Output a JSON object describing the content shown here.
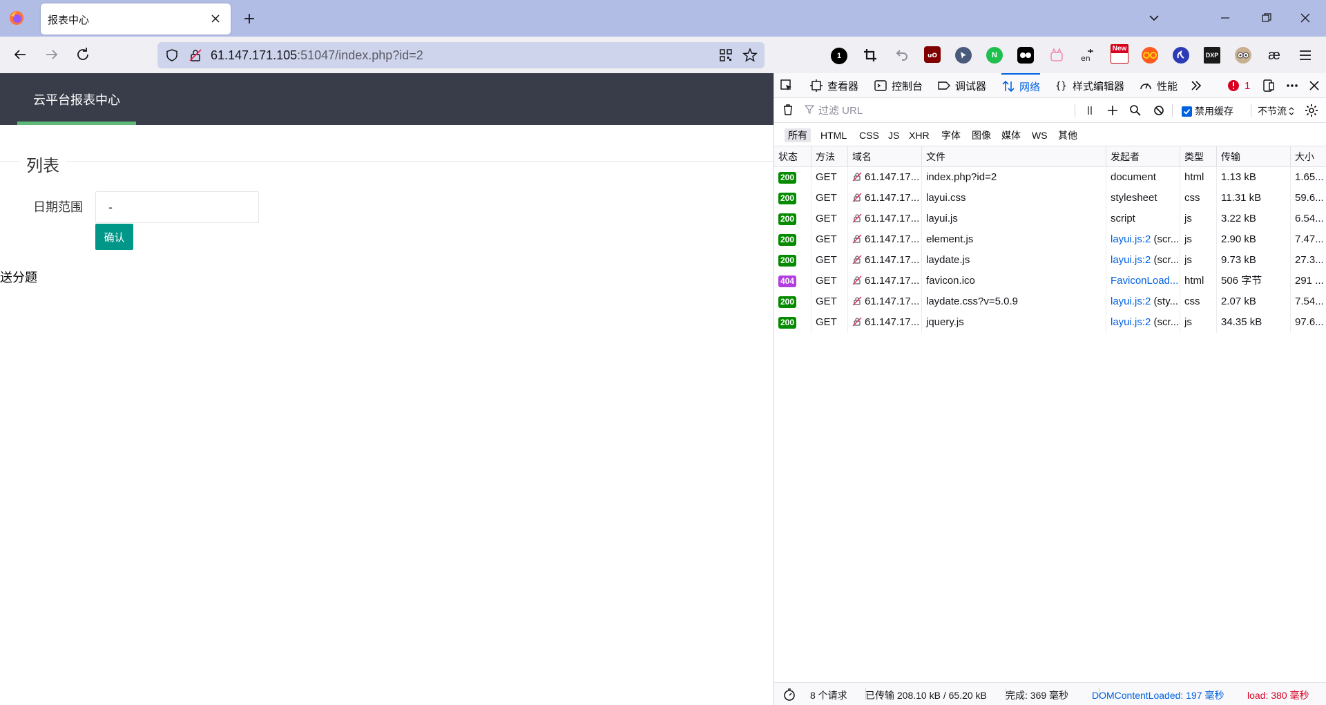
{
  "browser": {
    "tab_title": "报表中心",
    "url_host": "61.147.171.105",
    "url_rest": ":51047/index.php?id=2"
  },
  "extensions": [
    "1",
    "crop",
    "undo",
    "uBlock",
    "cursor",
    "N",
    "tampermonkey",
    "cat",
    "en",
    "New",
    "glasses",
    "sync",
    "DXP",
    "owl",
    "æ"
  ],
  "page": {
    "app_title": "云平台报表中心",
    "section_title": "列表",
    "date_label": "日期范围",
    "date_value": "-",
    "confirm_label": "确认",
    "bonus_text": "送分题"
  },
  "devtools": {
    "tabs": {
      "inspector": "查看器",
      "console": "控制台",
      "debugger": "调试器",
      "network": "网络",
      "style_editor": "样式编辑器",
      "performance": "性能"
    },
    "error_count": "1",
    "filter_placeholder": "过滤 URL",
    "disable_cache": "禁用缓存",
    "throttle": "不节流",
    "type_filters": [
      "所有",
      "HTML",
      "CSS",
      "JS",
      "XHR",
      "字体",
      "图像",
      "媒体",
      "WS",
      "其他"
    ],
    "columns": [
      "状态",
      "方法",
      "域名",
      "文件",
      "发起者",
      "类型",
      "传输",
      "大小"
    ],
    "requests": [
      {
        "status": "200",
        "method": "GET",
        "domain": "61.147.17...",
        "file": "index.php?id=2",
        "initiator": "document",
        "initiator_extra": "",
        "type": "html",
        "transfer": "1.13 kB",
        "size": "1.65..."
      },
      {
        "status": "200",
        "method": "GET",
        "domain": "61.147.17...",
        "file": "layui.css",
        "initiator": "stylesheet",
        "initiator_extra": "",
        "type": "css",
        "transfer": "11.31 kB",
        "size": "59.6..."
      },
      {
        "status": "200",
        "method": "GET",
        "domain": "61.147.17...",
        "file": "layui.js",
        "initiator": "script",
        "initiator_extra": "",
        "type": "js",
        "transfer": "3.22 kB",
        "size": "6.54..."
      },
      {
        "status": "200",
        "method": "GET",
        "domain": "61.147.17...",
        "file": "element.js",
        "initiator": "layui.js:2",
        "initiator_extra": " (scr...",
        "type": "js",
        "transfer": "2.90 kB",
        "size": "7.47..."
      },
      {
        "status": "200",
        "method": "GET",
        "domain": "61.147.17...",
        "file": "laydate.js",
        "initiator": "layui.js:2",
        "initiator_extra": " (scr...",
        "type": "js",
        "transfer": "9.73 kB",
        "size": "27.3..."
      },
      {
        "status": "404",
        "method": "GET",
        "domain": "61.147.17...",
        "file": "favicon.ico",
        "initiator": "FaviconLoad...",
        "initiator_extra": "",
        "type": "html",
        "transfer": "506 字节",
        "size": "291 ..."
      },
      {
        "status": "200",
        "method": "GET",
        "domain": "61.147.17...",
        "file": "laydate.css?v=5.0.9",
        "initiator": "layui.js:2",
        "initiator_extra": " (sty...",
        "type": "css",
        "transfer": "2.07 kB",
        "size": "7.54..."
      },
      {
        "status": "200",
        "method": "GET",
        "domain": "61.147.17...",
        "file": "jquery.js",
        "initiator": "layui.js:2",
        "initiator_extra": " (scr...",
        "type": "js",
        "transfer": "34.35 kB",
        "size": "97.6..."
      }
    ],
    "statusbar": {
      "requests": "8 个请求",
      "transferred": "已传输 208.10 kB / 65.20 kB",
      "finish": "完成: 369 毫秒",
      "dom_loaded": "DOMContentLoaded: 197 毫秒",
      "load": "load: 380 毫秒"
    }
  },
  "colors": {
    "status_ok": "#058b00",
    "status_404": "#b33de0",
    "load_color": "#d70022",
    "dom_color": "#0061e0"
  }
}
